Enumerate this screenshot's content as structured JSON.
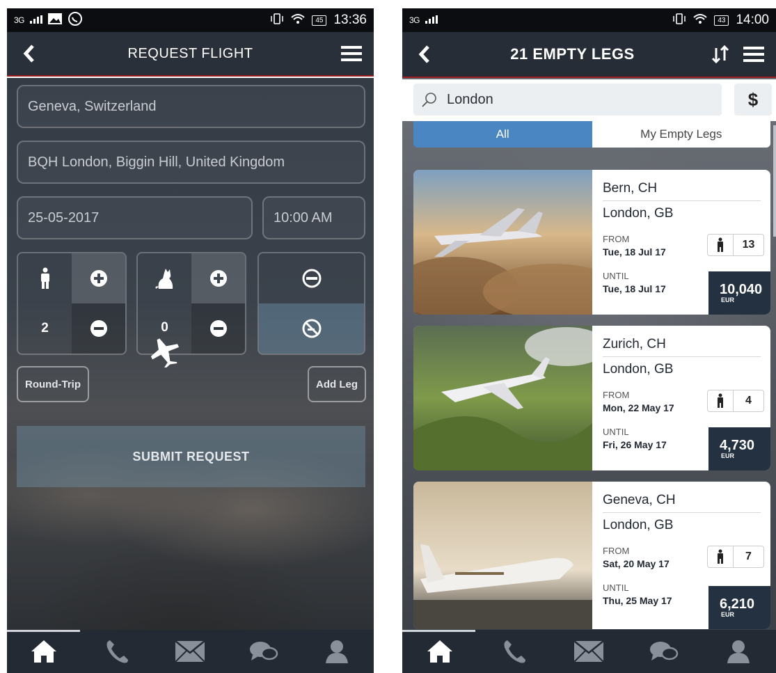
{
  "left": {
    "status": {
      "network": "3G",
      "battery": "45",
      "time": "13:36"
    },
    "header": {
      "title": "REQUEST FLIGHT"
    },
    "form": {
      "from": "Geneva, Switzerland",
      "to": "BQH London, Biggin Hill, United Kingdom",
      "date": "25-05-2017",
      "time": "10:00 AM",
      "passengers": "2",
      "pets": "0",
      "roundtrip_label": "Round-Trip",
      "addleg_label": "Add Leg",
      "submit_label": "SUBMIT REQUEST"
    },
    "icons": [
      "back-icon",
      "menu-icon",
      "person-icon",
      "plus-icon",
      "minus-icon",
      "pet-icon",
      "smoking-icon",
      "no-smoking-icon",
      "plane-icon"
    ],
    "nav": [
      "home-icon",
      "phone-icon",
      "mail-icon",
      "chat-icon",
      "profile-icon"
    ]
  },
  "right": {
    "status": {
      "network": "3G",
      "battery": "43",
      "time": "14:00"
    },
    "header": {
      "title": "21 EMPTY LEGS"
    },
    "search": {
      "value": "London"
    },
    "currency_label": "$",
    "tabs": {
      "all": "All",
      "mine": "My Empty Legs"
    },
    "legs": [
      {
        "from": "Bern, CH",
        "to": "London, GB",
        "from_label": "FROM",
        "from_date": "Tue, 18 Jul 17",
        "until_label": "UNTIL",
        "until_date": "Tue, 18 Jul 17",
        "pax": "13",
        "price": "10,040",
        "currency": "EUR"
      },
      {
        "from": "Zurich, CH",
        "to": "London, GB",
        "from_label": "FROM",
        "from_date": "Mon, 22 May 17",
        "until_label": "UNTIL",
        "until_date": "Fri, 26 May 17",
        "pax": "4",
        "price": "4,730",
        "currency": "EUR"
      },
      {
        "from": "Geneva, CH",
        "to": "London, GB",
        "from_label": "FROM",
        "from_date": "Sat, 20 May 17",
        "until_label": "UNTIL",
        "until_date": "Thu, 25 May 17",
        "pax": "7",
        "price": "6,210",
        "currency": "EUR"
      }
    ],
    "colors": {
      "header": "#272d36",
      "accent_red": "#9b1b1f",
      "tab_active": "#4a86c2",
      "price_bg": "#243140"
    }
  }
}
